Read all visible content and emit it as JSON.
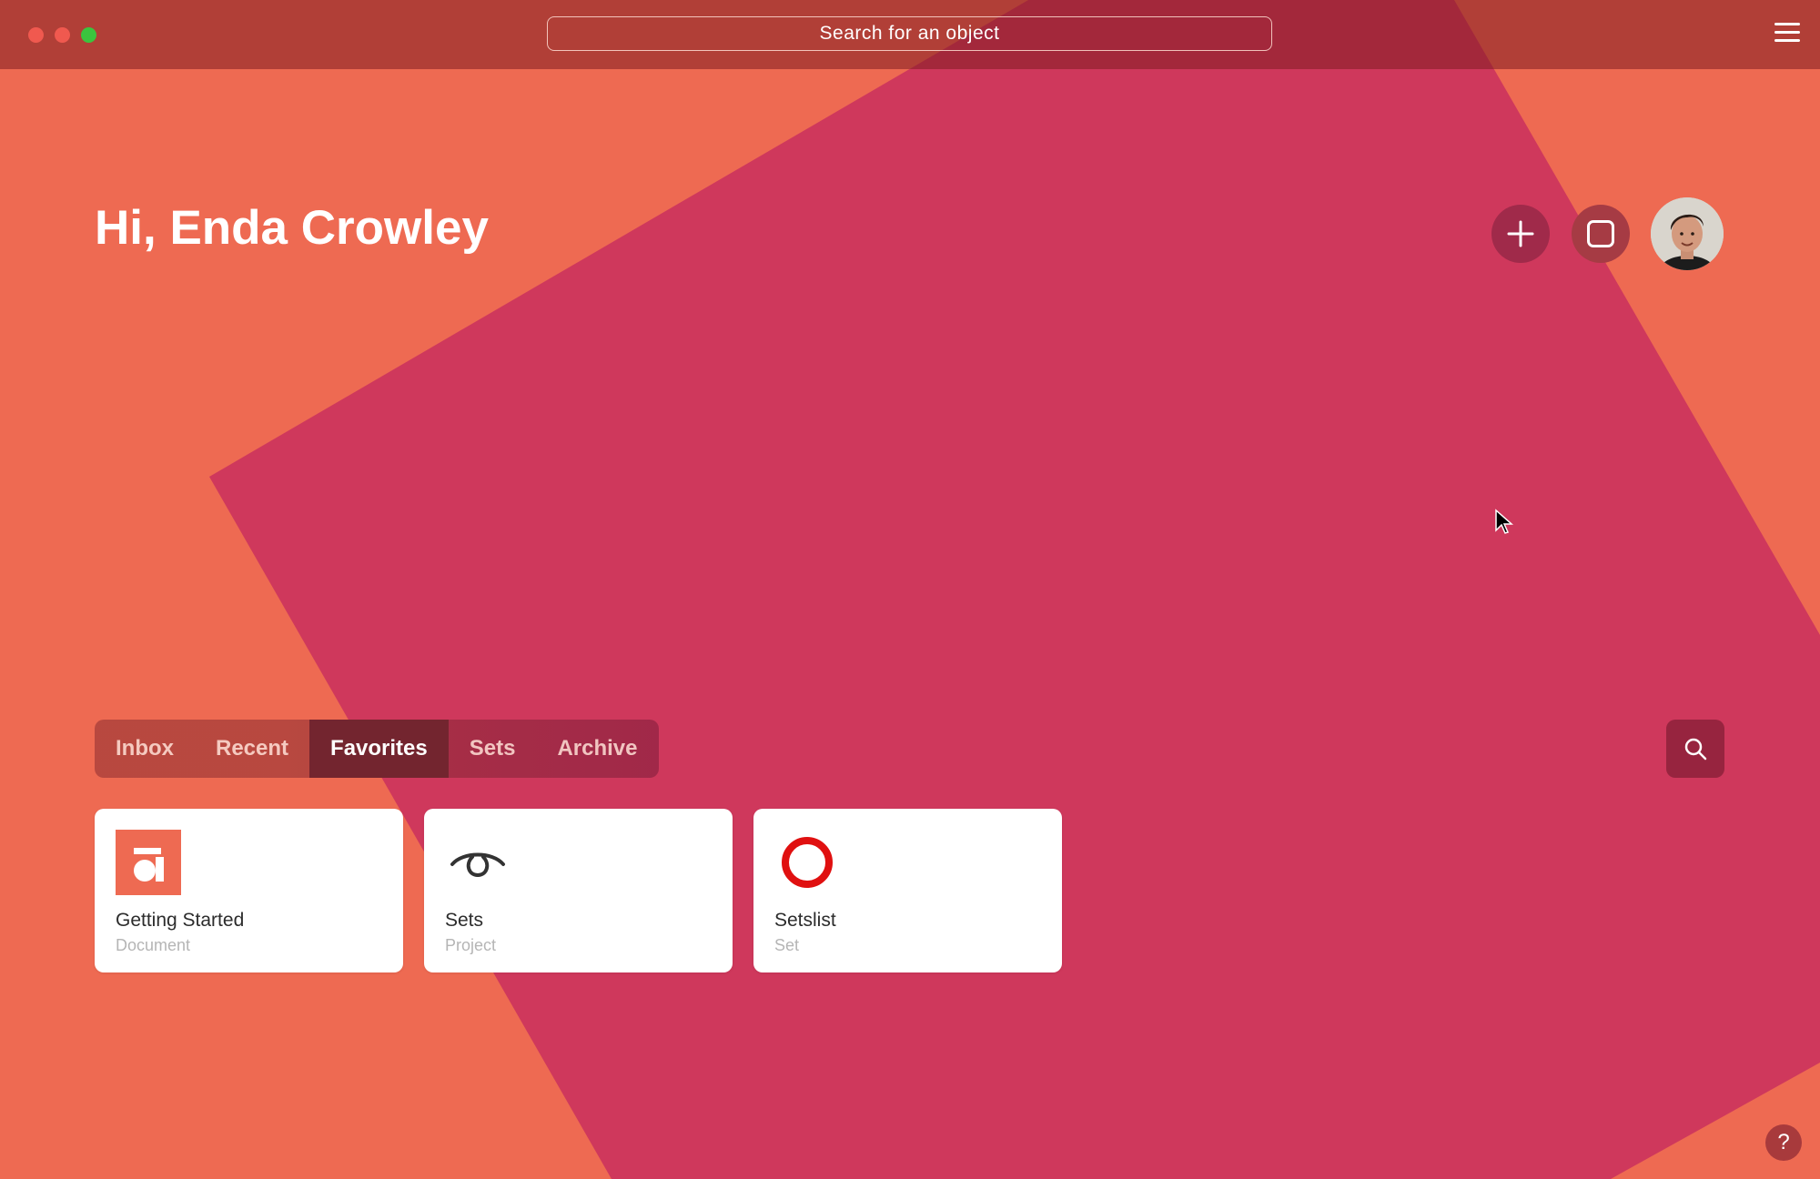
{
  "window": {
    "search_placeholder": "Search for an object"
  },
  "header": {
    "greeting": "Hi, Enda Crowley"
  },
  "tabs": [
    {
      "label": "Inbox",
      "active": false
    },
    {
      "label": "Recent",
      "active": false
    },
    {
      "label": "Favorites",
      "active": true
    },
    {
      "label": "Sets",
      "active": false
    },
    {
      "label": "Archive",
      "active": false
    }
  ],
  "cards": [
    {
      "title": "Getting Started",
      "type": "Document",
      "icon": "document-icon"
    },
    {
      "title": "Sets",
      "type": "Project",
      "icon": "loop-icon"
    },
    {
      "title": "Setslist",
      "type": "Set",
      "icon": "ring-icon"
    }
  ],
  "help": {
    "label": "?"
  },
  "colors": {
    "background": "#EE6A52",
    "shape": "#CF385C",
    "active_tab": "#73252F",
    "ring": "#E01010"
  }
}
